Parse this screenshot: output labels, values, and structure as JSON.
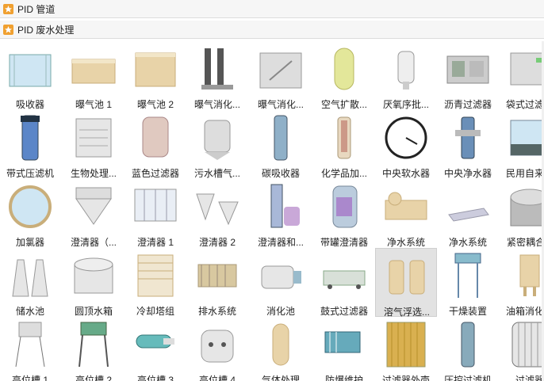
{
  "panels": [
    {
      "title": "PID 管道"
    },
    {
      "title": "PID 废水处理"
    }
  ],
  "items": [
    {
      "label": "吸收器",
      "icon": "absorber-tank-icon"
    },
    {
      "label": "曝气池 1",
      "icon": "aeration-tank-icon"
    },
    {
      "label": "曝气池 2",
      "icon": "aeration-tank-icon"
    },
    {
      "label": "曝气消化...",
      "icon": "aeration-digester-icon"
    },
    {
      "label": "曝气消化...",
      "icon": "aeration-digester-tank-icon"
    },
    {
      "label": "空气扩散...",
      "icon": "air-diffuser-icon"
    },
    {
      "label": "厌氧序批...",
      "icon": "anaerobic-batch-reactor-icon"
    },
    {
      "label": "沥青过滤器",
      "icon": "asphalt-filter-icon"
    },
    {
      "label": "袋式过滤器",
      "icon": "bag-filter-icon"
    },
    {
      "label": "带式压滤机",
      "icon": "belt-filter-press-icon"
    },
    {
      "label": "生物处理...",
      "icon": "biological-treatment-icon"
    },
    {
      "label": "蓝色过滤器",
      "icon": "blue-filter-icon"
    },
    {
      "label": "污水槽气...",
      "icon": "sewage-tank-gas-icon"
    },
    {
      "label": "碳吸收器",
      "icon": "carbon-absorber-icon"
    },
    {
      "label": "化学品加...",
      "icon": "chemical-feeder-icon"
    },
    {
      "label": "中央软水器",
      "icon": "water-softener-gauge-icon"
    },
    {
      "label": "中央净水器",
      "icon": "central-water-purifier-icon"
    },
    {
      "label": "民用自来水",
      "icon": "domestic-water-tank-icon"
    },
    {
      "label": "加氯器",
      "icon": "chlorinator-icon"
    },
    {
      "label": "澄清器（...",
      "icon": "clarifier-funnel-icon"
    },
    {
      "label": "澄清器 1",
      "icon": "clarifier-tank-icon"
    },
    {
      "label": "澄清器 2",
      "icon": "clarifier-cones-icon"
    },
    {
      "label": "澄清器和...",
      "icon": "clarifier-system-icon"
    },
    {
      "label": "带罐澄清器",
      "icon": "clarifier-with-tank-icon"
    },
    {
      "label": "净水系统",
      "icon": "water-purification-system-icon"
    },
    {
      "label": "净水系统",
      "icon": "water-purification-plate-icon"
    },
    {
      "label": "紧密耦合...",
      "icon": "close-coupled-tank-icon"
    },
    {
      "label": "储水池",
      "icon": "cooling-tower-reservoir-icon"
    },
    {
      "label": "圆顶水箱",
      "icon": "dome-water-tank-icon"
    },
    {
      "label": "冷却塔组",
      "icon": "cooling-tower-group-icon"
    },
    {
      "label": "排水系统",
      "icon": "drainage-system-icon"
    },
    {
      "label": "消化池",
      "icon": "digester-icon"
    },
    {
      "label": "鼓式过滤器",
      "icon": "drum-filter-icon"
    },
    {
      "label": "溶气浮选...",
      "icon": "dissolved-air-flotation-icon"
    },
    {
      "label": "干燥装置",
      "icon": "drying-unit-icon"
    },
    {
      "label": "油箱消化池",
      "icon": "oil-tank-digester-icon"
    },
    {
      "label": "高位槽 1",
      "icon": "elevated-tank-icon"
    },
    {
      "label": "高位槽 2",
      "icon": "elevated-tank-tower-icon"
    },
    {
      "label": "高位槽 3",
      "icon": "elevated-tank-horizontal-icon"
    },
    {
      "label": "高位槽 4",
      "icon": "elevated-tank-round-icon"
    },
    {
      "label": "气体处理",
      "icon": "gas-treatment-icon"
    },
    {
      "label": "防爆维护",
      "icon": "explosion-proof-icon"
    },
    {
      "label": "过滤器外壳",
      "icon": "filter-housing-icon"
    },
    {
      "label": "压控过滤机",
      "icon": "pressure-filter-icon"
    },
    {
      "label": "过滤器",
      "icon": "filter-icon"
    }
  ],
  "selected_index": 33,
  "colors": {
    "header_icon": "#f0a030",
    "selection": "#e2e2e2"
  }
}
